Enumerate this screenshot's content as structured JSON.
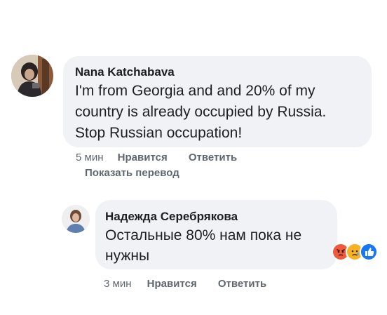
{
  "comments": [
    {
      "author": "Nana Katchabava",
      "text_lines": [
        "I'm from Georgia and and 20% of my",
        "country is already occupied by Russia.",
        "Stop Russian occupation!"
      ],
      "time": "5 мин",
      "like_label": "Нравится",
      "reply_label": "Ответить",
      "translate_label": "Показать перевод"
    },
    {
      "author": "Надежда Серебрякова",
      "text_lines": [
        "Остальные 80% нам пока не",
        "нужны"
      ],
      "time": "3 мин",
      "like_label": "Нравится",
      "reply_label": "Ответить",
      "reactions": [
        "angry-reaction",
        "sad-reaction",
        "like-reaction"
      ]
    }
  ],
  "colors": {
    "bubble_bg": "#f0f2f5",
    "text": "#1c1e21",
    "meta": "#606770",
    "like_blue": "#1877f2",
    "angry": "#f0593c",
    "sad": "#f7b125"
  }
}
